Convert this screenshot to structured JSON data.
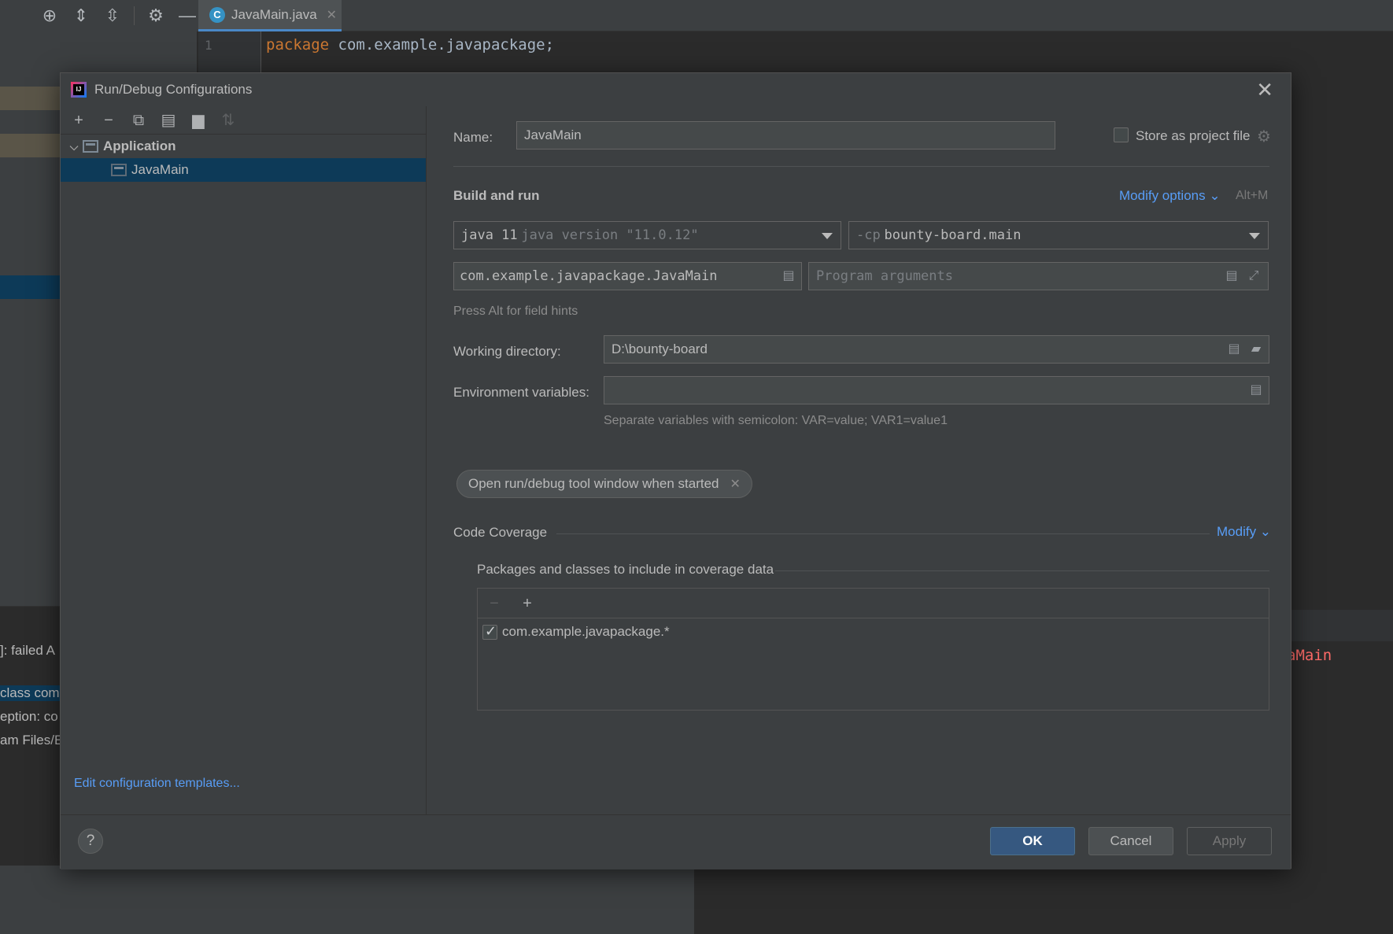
{
  "ide": {
    "tab_title": "JavaMain.java",
    "file_icon_letter": "C",
    "line_number": "1",
    "code_keyword": "package",
    "code_rest": " com.example.javapackage;",
    "run_lines": [
      "]: failed A",
      "class com",
      "eption: co",
      "am Files/E"
    ],
    "right_code_fragment": "aMain"
  },
  "dialog": {
    "title": "Run/Debug Configurations",
    "logo_text": "IJ",
    "tree": {
      "group_label": "Application",
      "child_label": "JavaMain"
    },
    "edit_templates_link": "Edit configuration templates...",
    "name_label": "Name:",
    "name_value": "JavaMain",
    "store_label": "Store as project file",
    "build_run_title": "Build and run",
    "modify_options_label": "Modify options",
    "modify_options_shortcut": "Alt+M",
    "jre_main": "java 11",
    "jre_detail": "java version \"11.0.12\"",
    "cp_flag": "-cp",
    "cp_value": "bounty-board.main",
    "main_class": "com.example.javapackage.JavaMain",
    "program_args_placeholder": "Program arguments",
    "field_hints": "Press Alt for field hints",
    "working_dir_label": "Working directory:",
    "working_dir_value": "D:\\bounty-board",
    "env_label": "Environment variables:",
    "env_value": "",
    "env_hint": "Separate variables with semicolon: VAR=value; VAR1=value1",
    "chip_label": "Open run/debug tool window when started",
    "coverage_title": "Code Coverage",
    "coverage_modify": "Modify",
    "coverage_subtitle": "Packages and classes to include in coverage data",
    "coverage_items": [
      {
        "pattern": "com.example.javapackage.*",
        "checked": true
      }
    ],
    "buttons": {
      "ok": "OK",
      "cancel": "Cancel",
      "apply": "Apply",
      "help": "?"
    }
  }
}
